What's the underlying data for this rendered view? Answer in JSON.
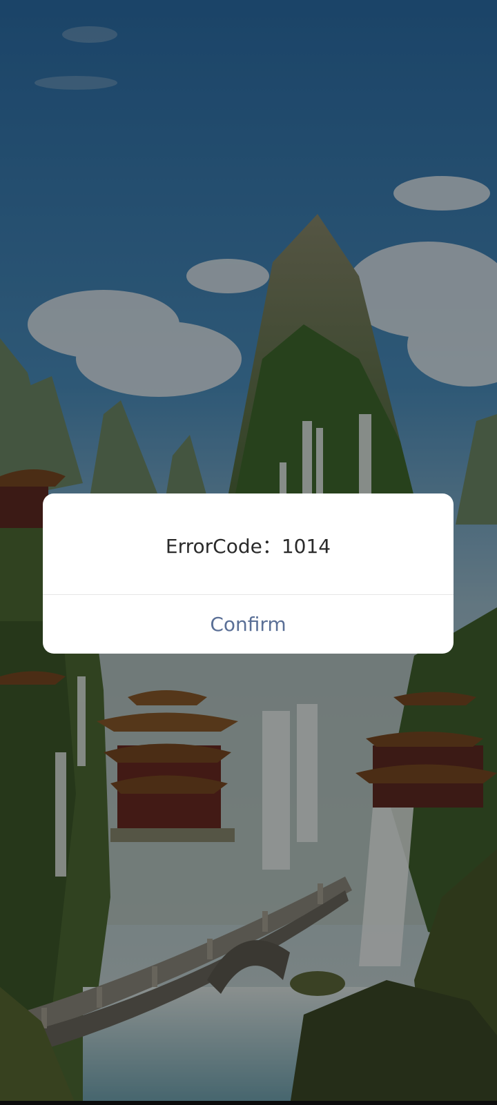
{
  "dialog": {
    "message": "ErrorCode：1014",
    "confirm_label": "Confirm"
  },
  "colors": {
    "confirm_text": "#5a6f96",
    "message_text": "#2a2a2a",
    "dialog_bg": "#ffffff",
    "overlay": "rgba(0,0,0,0.38)"
  }
}
